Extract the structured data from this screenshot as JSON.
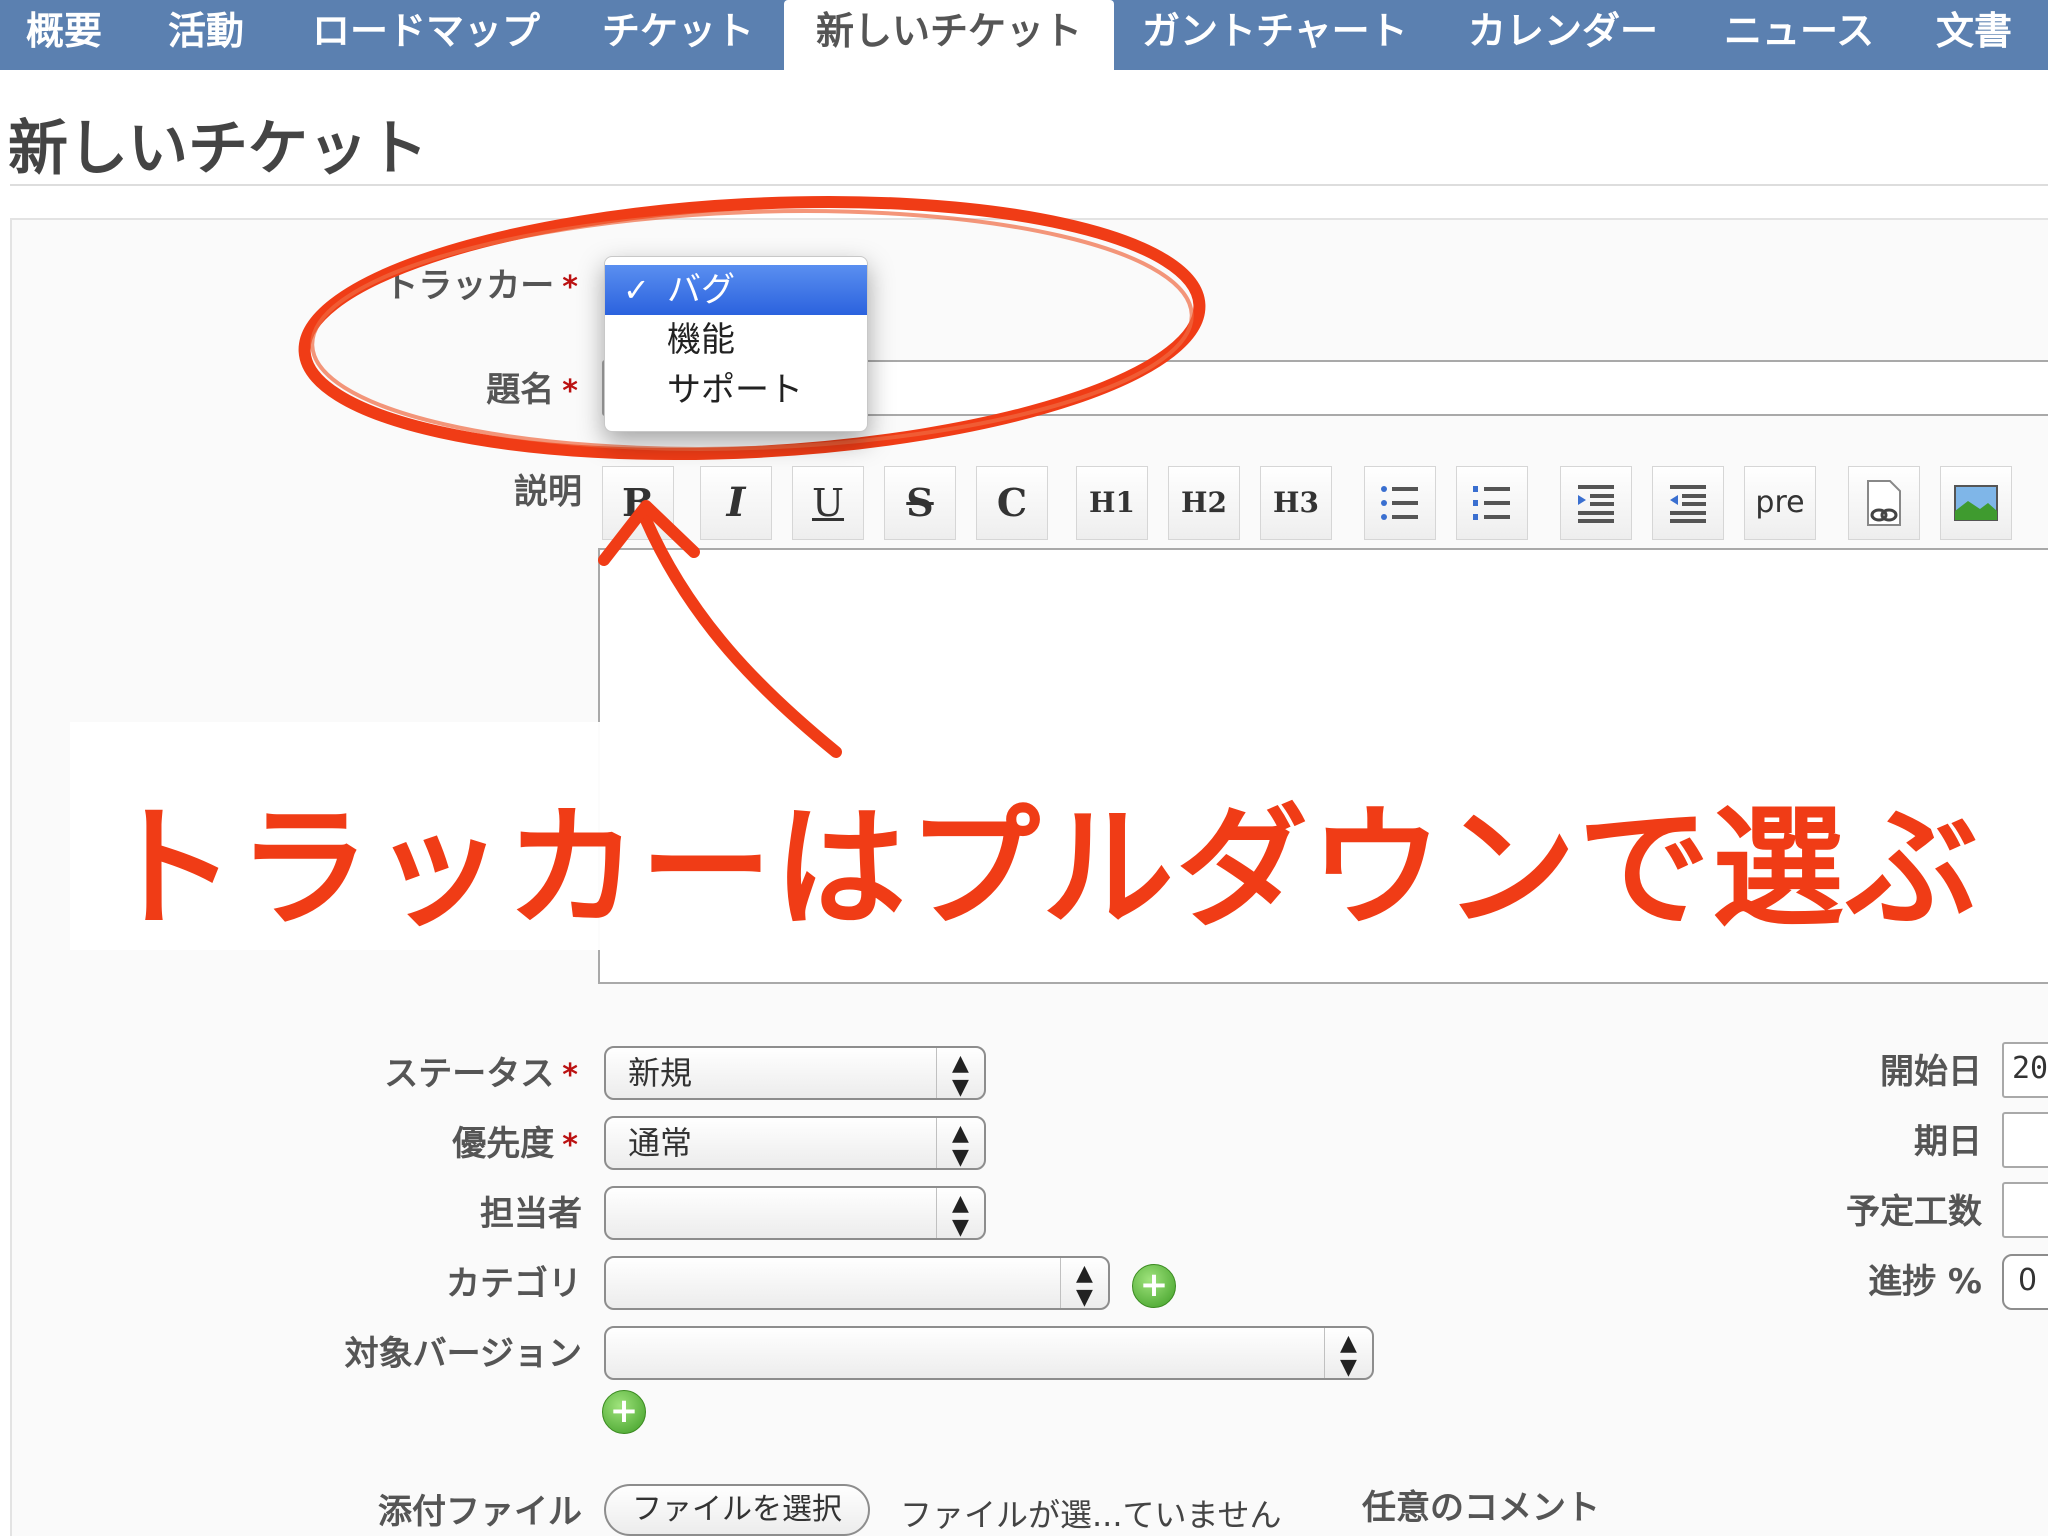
{
  "tabs": [
    {
      "label": "概要"
    },
    {
      "label": "活動"
    },
    {
      "label": "ロードマップ"
    },
    {
      "label": "チケット"
    },
    {
      "label": "新しいチケット",
      "selected": true
    },
    {
      "label": "ガントチャート"
    },
    {
      "label": "カレンダー"
    },
    {
      "label": "ニュース"
    },
    {
      "label": "文書"
    }
  ],
  "page": {
    "title": "新しいチケット"
  },
  "form": {
    "tracker_label": "トラッカー",
    "subject_label": "題名",
    "description_label": "説明",
    "required_mark": "*",
    "tracker_options": [
      {
        "label": "バグ",
        "selected": true
      },
      {
        "label": "機能"
      },
      {
        "label": "サポート"
      }
    ],
    "check_mark": "✓",
    "toolbar": [
      "B",
      "I",
      "U",
      "S",
      "C",
      "H1",
      "H2",
      "H3",
      "ul",
      "ol",
      "indent-right",
      "indent-left",
      "pre",
      "link",
      "image"
    ],
    "toolbar_pre_label": "pre",
    "status_label": "ステータス",
    "status_value": "新規",
    "priority_label": "優先度",
    "priority_value": "通常",
    "assignee_label": "担当者",
    "category_label": "カテゴリ",
    "target_version_label": "対象バージョン",
    "start_date_label": "開始日",
    "start_date_value": "20",
    "due_date_label": "期日",
    "estimated_label": "予定工数",
    "done_label": "進捗 %",
    "done_value": "0",
    "attachment_label": "添付ファイル",
    "file_button_label": "ファイルを選択",
    "file_status": "ファイルが選...ていません",
    "comment_label": "任意のコメント"
  },
  "annotation": {
    "text": "トラッカーはプルダウンで選ぶ",
    "color": "#f03c16"
  },
  "colors": {
    "tab_bar": "#5b80b0",
    "dropdown_highlight": "#2b62de"
  }
}
